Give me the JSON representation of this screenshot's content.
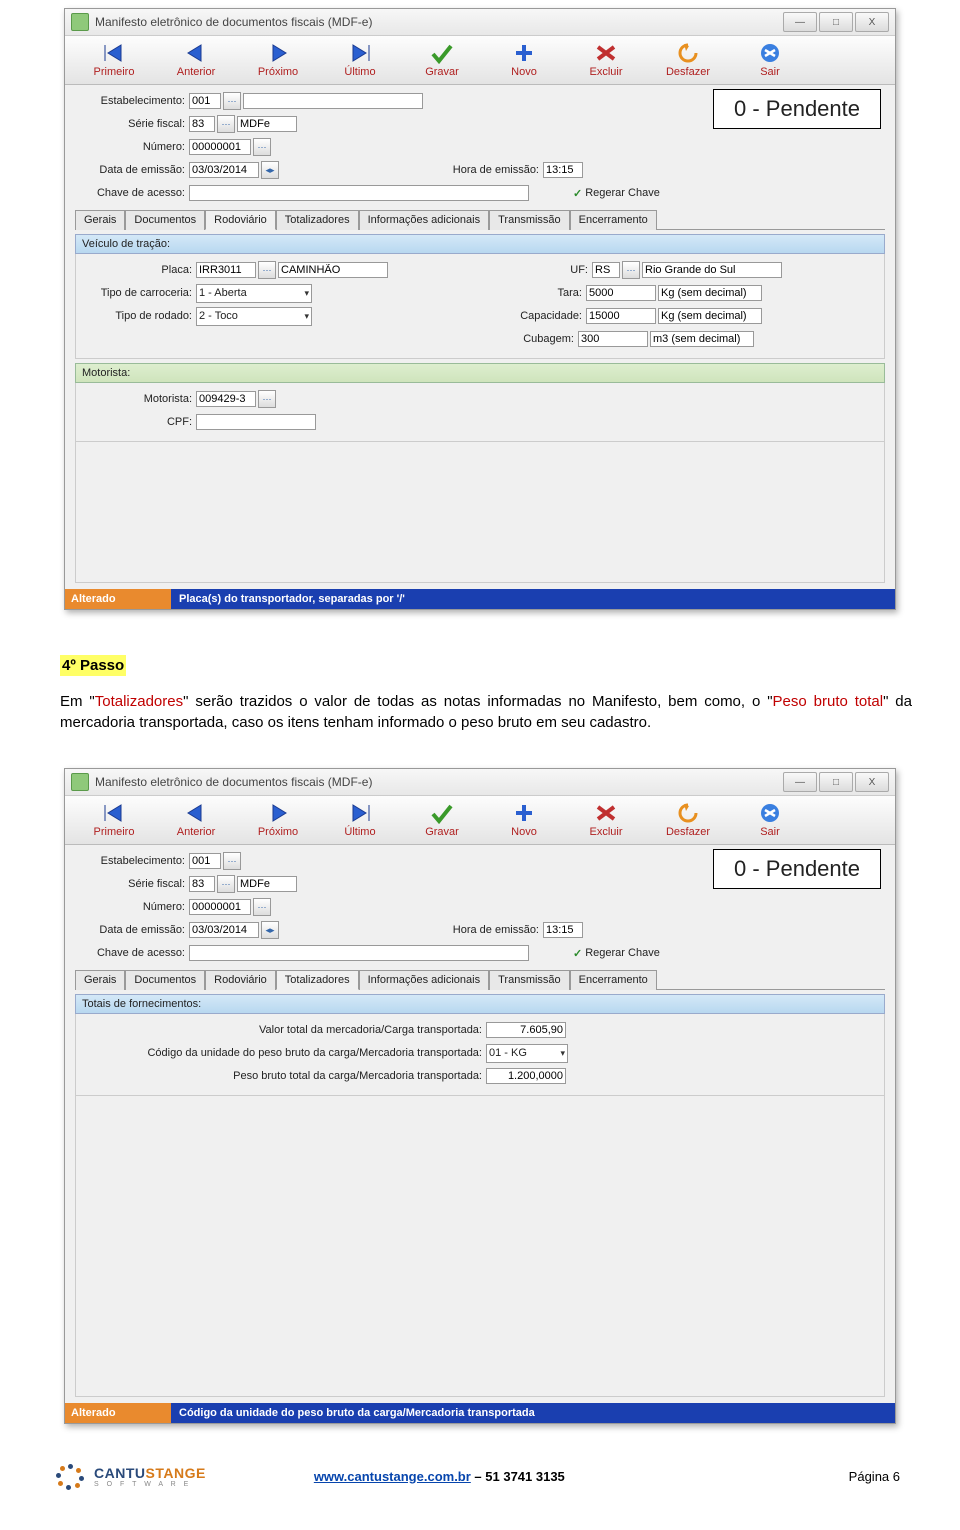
{
  "win": {
    "title": "Manifesto eletrônico de documentos fiscais (MDF-e)"
  },
  "toolbar": {
    "primeiro": "Primeiro",
    "anterior": "Anterior",
    "proximo": "Próximo",
    "ultimo": "Último",
    "gravar": "Gravar",
    "novo": "Novo",
    "excluir": "Excluir",
    "desfazer": "Desfazer",
    "sair": "Sair"
  },
  "fields": {
    "estabelecimento_lbl": "Estabelecimento:",
    "estabelecimento": "001",
    "serie_lbl": "Série fiscal:",
    "serie": "83",
    "serie_txt": "MDFe",
    "numero_lbl": "Número:",
    "numero": "00000001",
    "data_lbl": "Data de emissão:",
    "data": "03/03/2014",
    "hora_lbl": "Hora de emissão:",
    "hora": "13:15",
    "chave_lbl": "Chave de acesso:",
    "regerar": "Regerar Chave",
    "status": "0 - Pendente"
  },
  "tabs": [
    "Gerais",
    "Documentos",
    "Rodoviário",
    "Totalizadores",
    "Informações adicionais",
    "Transmissão",
    "Encerramento"
  ],
  "win1": {
    "active_tab": "Rodoviário",
    "veiculo_hdr": "Veículo de tração:",
    "placa_lbl": "Placa:",
    "placa": "IRR3011",
    "placa_txt": "CAMINHÃO",
    "tipocarr_lbl": "Tipo de carroceria:",
    "tipocarr": "1 - Aberta",
    "tiporod_lbl": "Tipo de rodado:",
    "tiporod": "2 - Toco",
    "uf_lbl": "UF:",
    "uf": "RS",
    "uf_txt": "Rio Grande do Sul",
    "tara_lbl": "Tara:",
    "tara": "5000",
    "kg": "Kg (sem decimal)",
    "cap_lbl": "Capacidade:",
    "cap": "15000",
    "cub_lbl": "Cubagem:",
    "cub": "300",
    "m3": "m3 (sem decimal)",
    "motorista_hdr": "Motorista:",
    "motorista_lbl": "Motorista:",
    "motorista": "009429-3",
    "cpf_lbl": "CPF:",
    "status_left": "Alterado",
    "status_right": "Placa(s) do transportador, separadas por '/'"
  },
  "text": {
    "step": "4º Passo",
    "p1a": "Em \"",
    "p1_tot": "Totalizadores",
    "p1b": "\" serão trazidos o valor de todas as notas informadas no Manifesto, bem como, o \"",
    "p1_peso": "Peso bruto total",
    "p1c": "\" da mercadoria transportada, caso os itens tenham informado o peso bruto em seu cadastro."
  },
  "win2": {
    "active_tab": "Totalizadores",
    "hdr": "Totais de fornecimentos:",
    "valor_lbl": "Valor total da mercadoria/Carga transportada:",
    "valor": "7.605,90",
    "cod_lbl": "Código da unidade do peso bruto da carga/Mercadoria transportada:",
    "cod": "01 - KG",
    "peso_lbl": "Peso bruto total da carga/Mercadoria transportada:",
    "peso": "1.200,0000",
    "status_left": "Alterado",
    "status_right": "Código da unidade do peso bruto da carga/Mercadoria transportada"
  },
  "footer": {
    "url": "www.cantustange.com.br",
    "phone": " – 51 3741 3135",
    "page": "Página 6",
    "brand1": "CANTU",
    "brand2": "STANGE",
    "brand_sub": "S O F T W A R E"
  }
}
